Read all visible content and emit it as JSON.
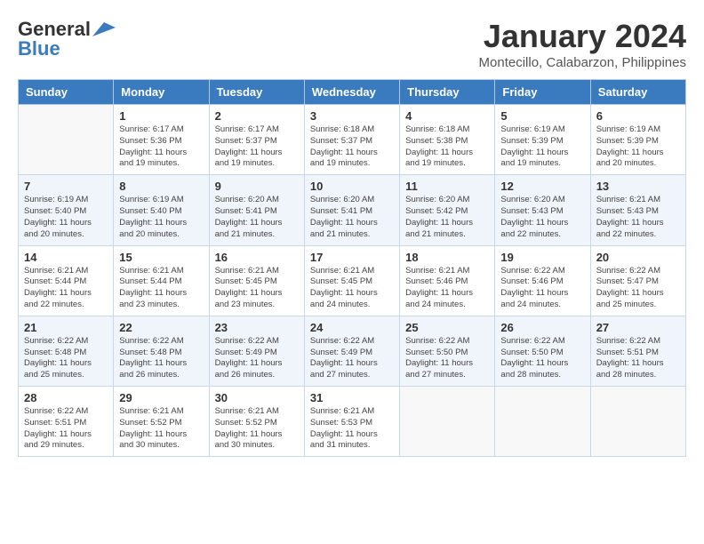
{
  "header": {
    "logo_general": "General",
    "logo_blue": "Blue",
    "month_title": "January 2024",
    "location": "Montecillo, Calabarzon, Philippines"
  },
  "days_of_week": [
    "Sunday",
    "Monday",
    "Tuesday",
    "Wednesday",
    "Thursday",
    "Friday",
    "Saturday"
  ],
  "weeks": [
    [
      {
        "day": "",
        "empty": true
      },
      {
        "day": "1",
        "sunrise": "6:17 AM",
        "sunset": "5:36 PM",
        "daylight": "11 hours and 19 minutes."
      },
      {
        "day": "2",
        "sunrise": "6:17 AM",
        "sunset": "5:37 PM",
        "daylight": "11 hours and 19 minutes."
      },
      {
        "day": "3",
        "sunrise": "6:18 AM",
        "sunset": "5:37 PM",
        "daylight": "11 hours and 19 minutes."
      },
      {
        "day": "4",
        "sunrise": "6:18 AM",
        "sunset": "5:38 PM",
        "daylight": "11 hours and 19 minutes."
      },
      {
        "day": "5",
        "sunrise": "6:19 AM",
        "sunset": "5:39 PM",
        "daylight": "11 hours and 19 minutes."
      },
      {
        "day": "6",
        "sunrise": "6:19 AM",
        "sunset": "5:39 PM",
        "daylight": "11 hours and 20 minutes."
      }
    ],
    [
      {
        "day": "7",
        "sunrise": "6:19 AM",
        "sunset": "5:40 PM",
        "daylight": "11 hours and 20 minutes."
      },
      {
        "day": "8",
        "sunrise": "6:19 AM",
        "sunset": "5:40 PM",
        "daylight": "11 hours and 20 minutes."
      },
      {
        "day": "9",
        "sunrise": "6:20 AM",
        "sunset": "5:41 PM",
        "daylight": "11 hours and 21 minutes."
      },
      {
        "day": "10",
        "sunrise": "6:20 AM",
        "sunset": "5:41 PM",
        "daylight": "11 hours and 21 minutes."
      },
      {
        "day": "11",
        "sunrise": "6:20 AM",
        "sunset": "5:42 PM",
        "daylight": "11 hours and 21 minutes."
      },
      {
        "day": "12",
        "sunrise": "6:20 AM",
        "sunset": "5:43 PM",
        "daylight": "11 hours and 22 minutes."
      },
      {
        "day": "13",
        "sunrise": "6:21 AM",
        "sunset": "5:43 PM",
        "daylight": "11 hours and 22 minutes."
      }
    ],
    [
      {
        "day": "14",
        "sunrise": "6:21 AM",
        "sunset": "5:44 PM",
        "daylight": "11 hours and 22 minutes."
      },
      {
        "day": "15",
        "sunrise": "6:21 AM",
        "sunset": "5:44 PM",
        "daylight": "11 hours and 23 minutes."
      },
      {
        "day": "16",
        "sunrise": "6:21 AM",
        "sunset": "5:45 PM",
        "daylight": "11 hours and 23 minutes."
      },
      {
        "day": "17",
        "sunrise": "6:21 AM",
        "sunset": "5:45 PM",
        "daylight": "11 hours and 24 minutes."
      },
      {
        "day": "18",
        "sunrise": "6:21 AM",
        "sunset": "5:46 PM",
        "daylight": "11 hours and 24 minutes."
      },
      {
        "day": "19",
        "sunrise": "6:22 AM",
        "sunset": "5:46 PM",
        "daylight": "11 hours and 24 minutes."
      },
      {
        "day": "20",
        "sunrise": "6:22 AM",
        "sunset": "5:47 PM",
        "daylight": "11 hours and 25 minutes."
      }
    ],
    [
      {
        "day": "21",
        "sunrise": "6:22 AM",
        "sunset": "5:48 PM",
        "daylight": "11 hours and 25 minutes."
      },
      {
        "day": "22",
        "sunrise": "6:22 AM",
        "sunset": "5:48 PM",
        "daylight": "11 hours and 26 minutes."
      },
      {
        "day": "23",
        "sunrise": "6:22 AM",
        "sunset": "5:49 PM",
        "daylight": "11 hours and 26 minutes."
      },
      {
        "day": "24",
        "sunrise": "6:22 AM",
        "sunset": "5:49 PM",
        "daylight": "11 hours and 27 minutes."
      },
      {
        "day": "25",
        "sunrise": "6:22 AM",
        "sunset": "5:50 PM",
        "daylight": "11 hours and 27 minutes."
      },
      {
        "day": "26",
        "sunrise": "6:22 AM",
        "sunset": "5:50 PM",
        "daylight": "11 hours and 28 minutes."
      },
      {
        "day": "27",
        "sunrise": "6:22 AM",
        "sunset": "5:51 PM",
        "daylight": "11 hours and 28 minutes."
      }
    ],
    [
      {
        "day": "28",
        "sunrise": "6:22 AM",
        "sunset": "5:51 PM",
        "daylight": "11 hours and 29 minutes."
      },
      {
        "day": "29",
        "sunrise": "6:21 AM",
        "sunset": "5:52 PM",
        "daylight": "11 hours and 30 minutes."
      },
      {
        "day": "30",
        "sunrise": "6:21 AM",
        "sunset": "5:52 PM",
        "daylight": "11 hours and 30 minutes."
      },
      {
        "day": "31",
        "sunrise": "6:21 AM",
        "sunset": "5:53 PM",
        "daylight": "11 hours and 31 minutes."
      },
      {
        "day": "",
        "empty": true
      },
      {
        "day": "",
        "empty": true
      },
      {
        "day": "",
        "empty": true
      }
    ]
  ]
}
